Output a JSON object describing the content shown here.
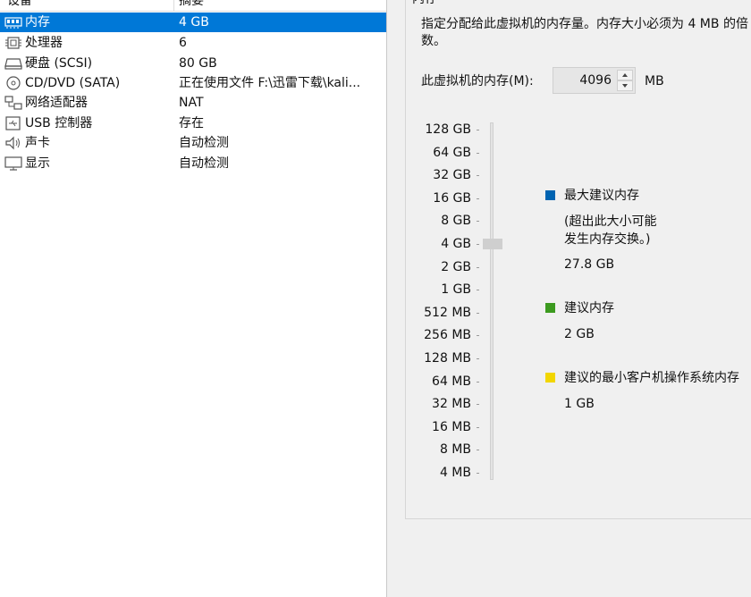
{
  "device_list": {
    "header": {
      "device": "设备",
      "summary": "摘要"
    },
    "items": [
      {
        "name": "内存",
        "summary": "4 GB",
        "icon": "memory-icon",
        "selected": true
      },
      {
        "name": "处理器",
        "summary": "6",
        "icon": "cpu-icon"
      },
      {
        "name": "硬盘 (SCSI)",
        "summary": "80 GB",
        "icon": "hard-disk-icon"
      },
      {
        "name": "CD/DVD (SATA)",
        "summary": "正在使用文件 F:\\迅雷下载\\kali...",
        "icon": "cd-dvd-icon"
      },
      {
        "name": "网络适配器",
        "summary": "NAT",
        "icon": "network-adapter-icon"
      },
      {
        "name": "USB 控制器",
        "summary": "存在",
        "icon": "usb-icon"
      },
      {
        "name": "声卡",
        "summary": "自动检测",
        "icon": "speaker-icon"
      },
      {
        "name": "显示",
        "summary": "自动检测",
        "icon": "monitor-icon"
      }
    ]
  },
  "memory": {
    "group_title": "内存",
    "description": "指定分配给此虚拟机的内存量。内存大小必须为 4 MB 的倍数。",
    "vm_memory_label": "此虚拟机的内存(M):",
    "vm_memory_value": "4096",
    "unit": "MB",
    "scale_labels": [
      "128 GB",
      "64 GB",
      "32 GB",
      "16 GB",
      "8 GB",
      "4 GB",
      "2 GB",
      "1 GB",
      "512 MB",
      "256 MB",
      "128 MB",
      "64 MB",
      "32 MB",
      "16 MB",
      "8 MB",
      "4 MB"
    ],
    "slider_value_label": "4 GB",
    "legend": {
      "max_recommended": {
        "title": "最大建议内存",
        "note_line1": "(超出此大小可能",
        "note_line2": "发生内存交换。)",
        "value": "27.8 GB",
        "color": "#0063b1"
      },
      "recommended": {
        "title": "建议内存",
        "value": "2 GB",
        "color": "#3c9a1f"
      },
      "min_guest": {
        "title": "建议的最小客户机操作系统内存",
        "value": "1 GB",
        "color": "#f2d600"
      }
    }
  }
}
